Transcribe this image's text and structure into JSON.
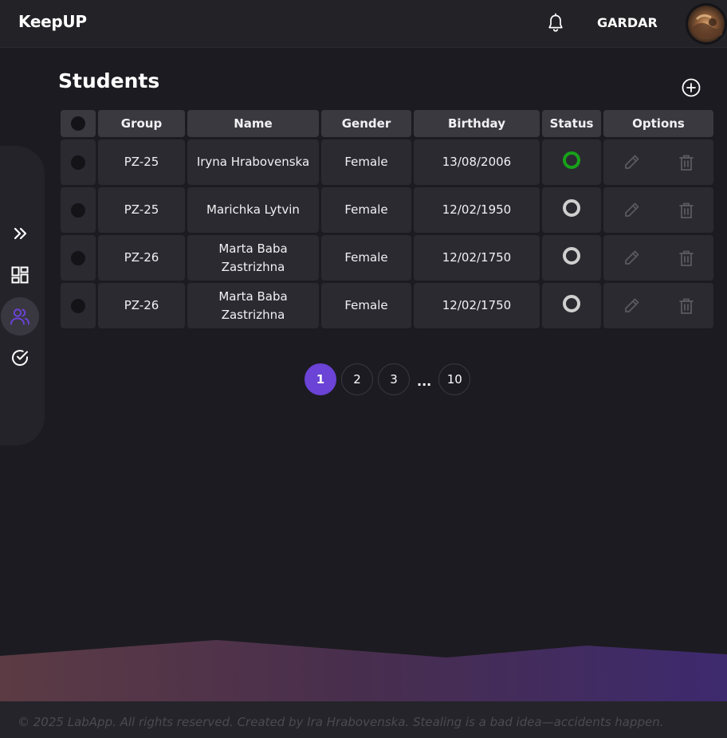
{
  "app": {
    "brand": "KeepUP"
  },
  "header": {
    "username": "GARDAR",
    "icons": {
      "notifications": "bell-icon",
      "avatar": "user-avatar"
    }
  },
  "sidebar": {
    "items": [
      {
        "icon": "double-chevron-right-icon",
        "active": false
      },
      {
        "icon": "dashboard-grid-icon",
        "active": false
      },
      {
        "icon": "users-icon",
        "active": true
      },
      {
        "icon": "check-circle-icon",
        "active": false
      }
    ],
    "accent": "#6b43d6"
  },
  "page": {
    "title": "Students",
    "add_icon": "plus-circle-icon"
  },
  "table": {
    "headers": [
      "Group",
      "Name",
      "Gender",
      "Birthday",
      "Status",
      "Options"
    ],
    "rows": [
      {
        "group": "PZ-25",
        "name": "Iryna Hrabovenska",
        "gender": "Female",
        "birthday": "13/08/2006",
        "status": "active"
      },
      {
        "group": "PZ-25",
        "name": "Marichka Lytvin",
        "gender": "Female",
        "birthday": "12/02/1950",
        "status": "inactive"
      },
      {
        "group": "PZ-26",
        "name": "Marta Baba Zastrizhna",
        "gender": "Female",
        "birthday": "12/02/1750",
        "status": "inactive"
      },
      {
        "group": "PZ-26",
        "name": "Marta Baba Zastrizhna",
        "gender": "Female",
        "birthday": "12/02/1750",
        "status": "inactive"
      }
    ],
    "option_icons": [
      "pencil-icon",
      "trash-icon"
    ],
    "status_colors": {
      "active": "#18a11a",
      "inactive": "#cfcfcf"
    }
  },
  "pagination": {
    "pages": [
      "1",
      "2",
      "3"
    ],
    "ellipsis": "...",
    "last": "10",
    "current": "1"
  },
  "footer": {
    "text": "© 2025 LabApp. All rights reserved. Created by Ira Hrabovenska. Stealing is a bad idea—accidents happen."
  }
}
